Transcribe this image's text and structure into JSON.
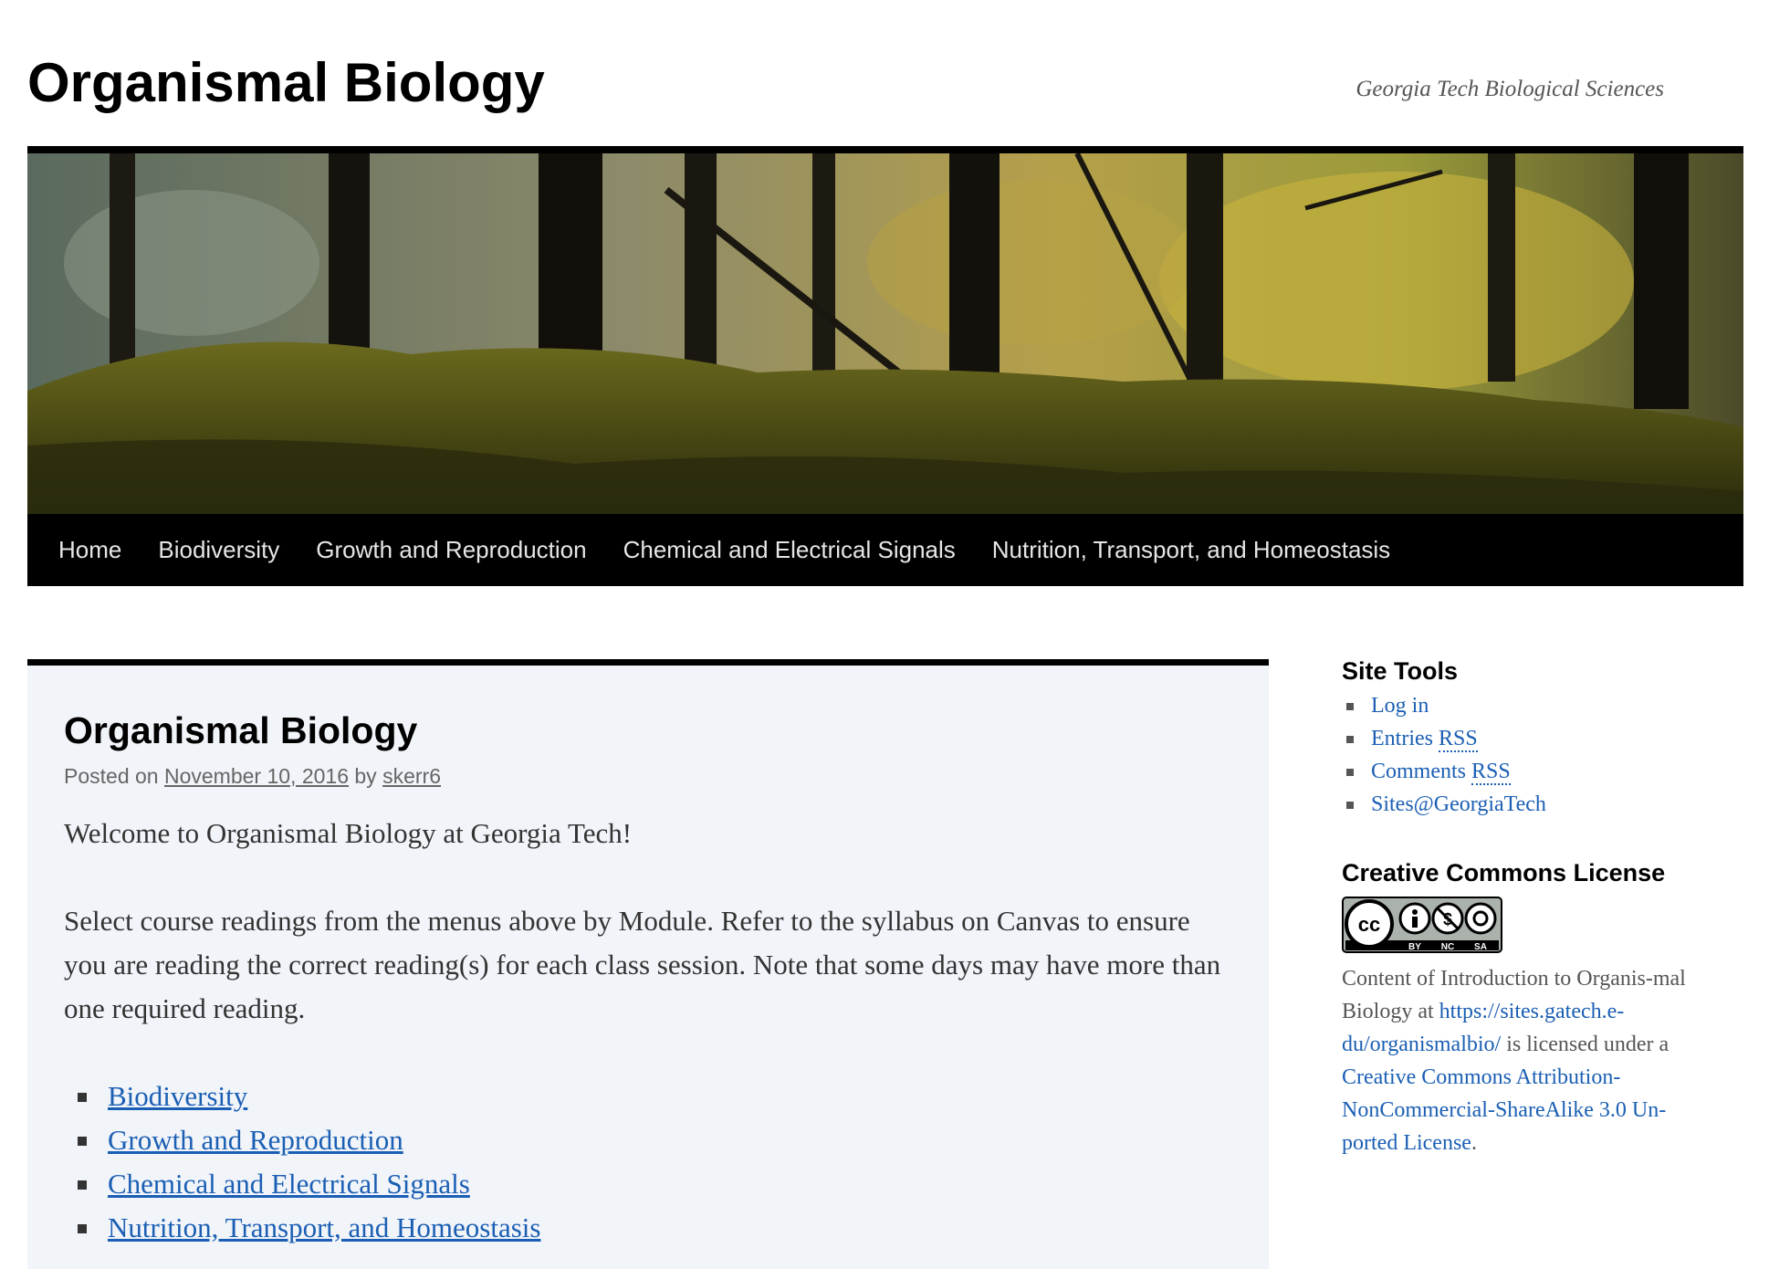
{
  "header": {
    "site_title": "Organismal Biology",
    "tagline": "Georgia Tech Biological Sciences"
  },
  "nav": {
    "items": [
      {
        "label": "Home"
      },
      {
        "label": "Biodiversity"
      },
      {
        "label": "Growth and Reproduction"
      },
      {
        "label": "Chemical and Electrical Signals"
      },
      {
        "label": "Nutrition, Transport, and Homeostasis"
      }
    ]
  },
  "article": {
    "title": "Organismal Biology",
    "posted_on": "Posted on",
    "date": "November 10, 2016",
    "by": "by",
    "author": "skerr6",
    "welcome": "Welcome to Organismal Biology at Georgia Tech!",
    "instructions": "Select course readings from the menus above by Module. Refer to the syllabus on Canvas to ensure you are reading the correct reading(s) for each class session. Note that some days may have more than one required reading.",
    "modules": [
      {
        "label": "Biodiversity"
      },
      {
        "label": "Growth and Reproduction"
      },
      {
        "label": "Chemical and Electrical Signals"
      },
      {
        "label": "Nutrition, Transport, and Homeostasis"
      }
    ]
  },
  "sidebar": {
    "site_tools": {
      "title": "Site Tools",
      "log_in": "Log in",
      "entries": "Entries",
      "comments": "Comments",
      "rss": "RSS",
      "sites": "Sites@GeorgiaTech"
    },
    "license": {
      "title": "Creative Commons License",
      "badge_cc": "cc",
      "badge_by": "BY",
      "badge_nc": "NC",
      "badge_sa": "SA",
      "text_1": "Content of Introduction to Organis-mal Biology at",
      "url": "https://sites.gatech.e-du/organismalbio/",
      "text_2": "is licensed under a",
      "license_name": "Creative Commons Attribution-NonCommercial-ShareAlike 3.0 Un-ported License",
      "period": "."
    }
  },
  "colors": {
    "link": "#1b5fb4",
    "nav_bg": "#000000",
    "article_bg": "#f1f4f9"
  }
}
